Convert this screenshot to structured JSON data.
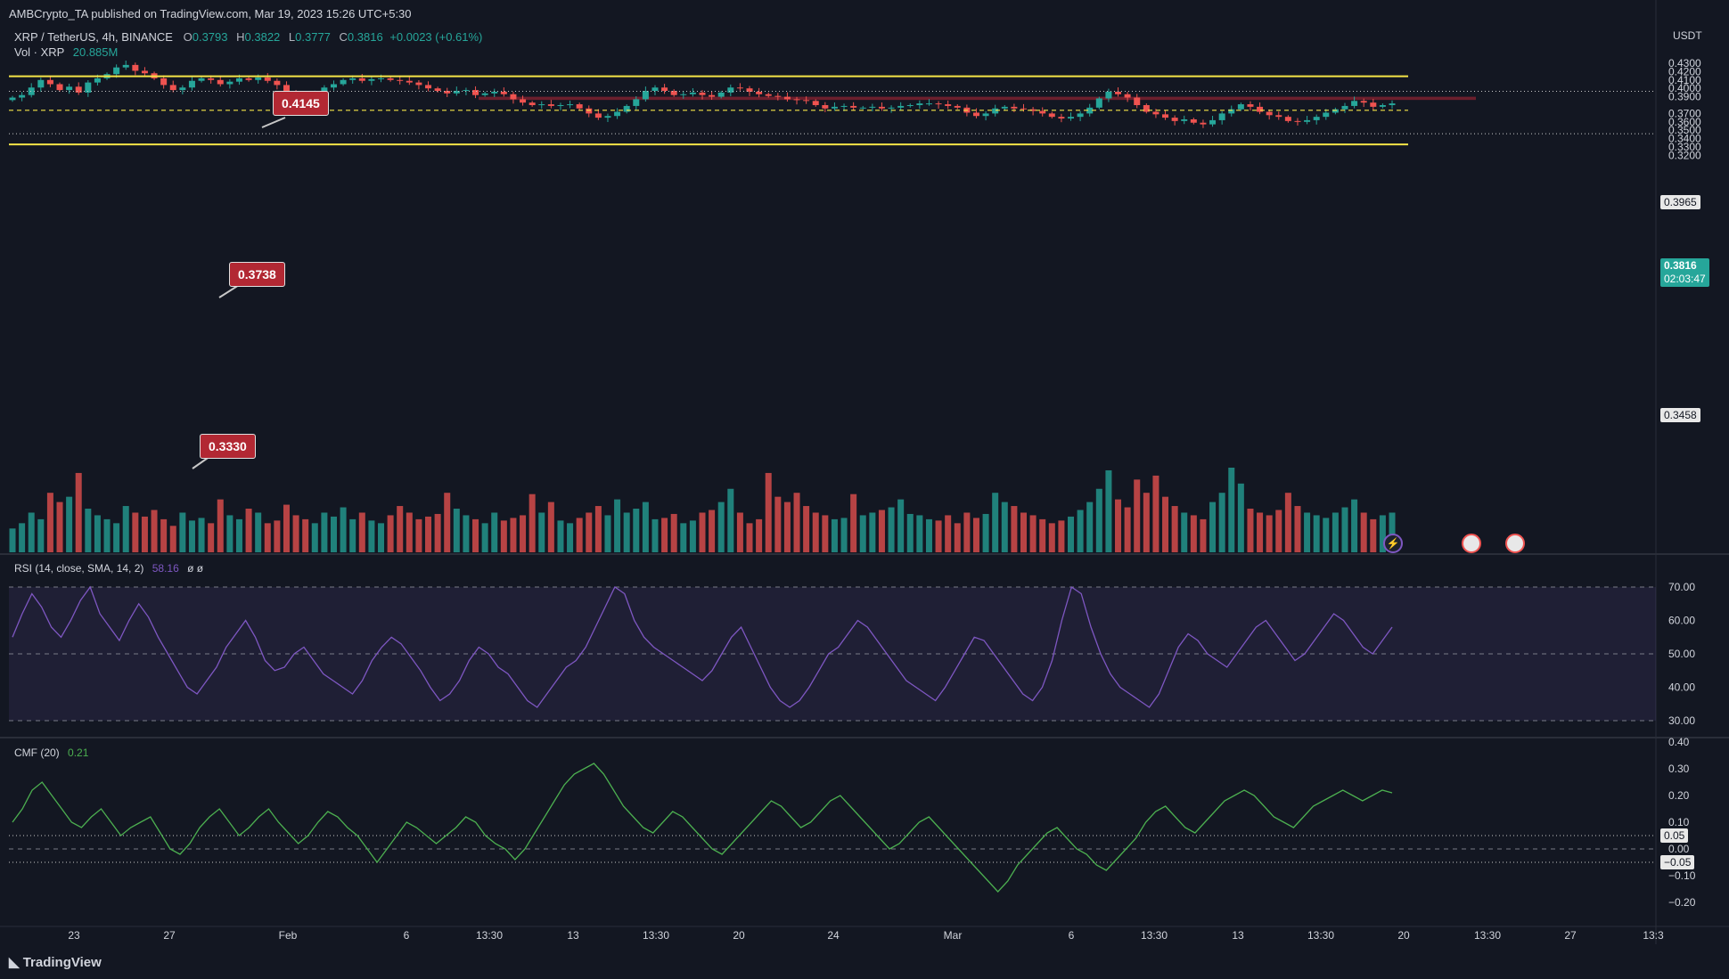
{
  "header": {
    "published": "AMBCrypto_TA published on TradingView.com, Mar 19, 2023 15:26 UTC+5:30",
    "symbol": "XRP / TetherUS, 4h, BINANCE",
    "o_label": "O",
    "o": "0.3793",
    "h_label": "H",
    "h": "0.3822",
    "l_label": "L",
    "l": "0.3777",
    "c_label": "C",
    "c": "0.3816",
    "change": "+0.0023 (+0.61%)",
    "vol_label": "Vol · XRP",
    "vol": "20.885M"
  },
  "currency": "USDT",
  "price_axis": [
    "0.4300",
    "0.4200",
    "0.4100",
    "0.4000",
    "0.3900",
    "0.3700",
    "0.3600",
    "0.3500",
    "0.3400",
    "0.3300",
    "0.3200"
  ],
  "price_tags": {
    "p3965": "0.3965",
    "p3816": "0.3816",
    "countdown": "02:03:47",
    "p3458": "0.3458"
  },
  "annotations": {
    "a1": "0.4145",
    "a2": "0.3738",
    "a3": "0.3330"
  },
  "rsi": {
    "label": "RSI (14, close, SMA, 14, 2)",
    "value": "58.16",
    "extra": "ø  ø",
    "axis": [
      "70.00",
      "60.00",
      "50.00",
      "40.00",
      "30.00"
    ]
  },
  "cmf": {
    "label": "CMF (20)",
    "value": "0.21",
    "axis": [
      "0.40",
      "0.30",
      "0.20",
      "0.10",
      "0.00",
      "−0.10",
      "−0.20"
    ],
    "tag_pos": "0.05",
    "tag_neg": "−0.05"
  },
  "time_axis": [
    "23",
    "27",
    "Feb",
    "6",
    "13:30",
    "13",
    "13:30",
    "20",
    "24",
    "Mar",
    "6",
    "13:30",
    "13",
    "13:30",
    "20",
    "13:30",
    "27",
    "13:3"
  ],
  "footer": {
    "logo": "TradingView"
  },
  "colors": {
    "up": "#26a69a",
    "down": "#ef5350",
    "level": "#f5e547",
    "zone": "#8b2332",
    "rsi": "#7e57c2",
    "cmf": "#4caf50"
  },
  "chart_data": {
    "type": "candlestick",
    "ylim": [
      0.313,
      0.433
    ],
    "levels": [
      0.4145,
      0.3738,
      0.333
    ],
    "dotted_levels": [
      0.3965,
      0.3458
    ],
    "resistance_zone": [
      0.3862,
      0.39
    ],
    "close_series": [
      0.389,
      0.392,
      0.401,
      0.41,
      0.405,
      0.398,
      0.402,
      0.395,
      0.407,
      0.412,
      0.417,
      0.425,
      0.428,
      0.421,
      0.418,
      0.412,
      0.404,
      0.398,
      0.401,
      0.409,
      0.412,
      0.41,
      0.405,
      0.408,
      0.412,
      0.41,
      0.413,
      0.409,
      0.404,
      0.396,
      0.39,
      0.387,
      0.392,
      0.401,
      0.405,
      0.41,
      0.412,
      0.409,
      0.411,
      0.412,
      0.41,
      0.409,
      0.407,
      0.404,
      0.4,
      0.397,
      0.394,
      0.397,
      0.398,
      0.392,
      0.394,
      0.396,
      0.393,
      0.387,
      0.383,
      0.38,
      0.381,
      0.379,
      0.38,
      0.381,
      0.376,
      0.37,
      0.365,
      0.367,
      0.372,
      0.379,
      0.387,
      0.397,
      0.401,
      0.397,
      0.392,
      0.393,
      0.395,
      0.392,
      0.39,
      0.395,
      0.401,
      0.4,
      0.396,
      0.393,
      0.391,
      0.39,
      0.387,
      0.386,
      0.385,
      0.38,
      0.376,
      0.378,
      0.379,
      0.377,
      0.377,
      0.378,
      0.376,
      0.377,
      0.379,
      0.38,
      0.382,
      0.382,
      0.381,
      0.379,
      0.377,
      0.371,
      0.367,
      0.37,
      0.376,
      0.378,
      0.376,
      0.375,
      0.373,
      0.37,
      0.366,
      0.364,
      0.366,
      0.37,
      0.377,
      0.388,
      0.396,
      0.393,
      0.389,
      0.38,
      0.372,
      0.369,
      0.365,
      0.361,
      0.363,
      0.359,
      0.357,
      0.362,
      0.37,
      0.375,
      0.381,
      0.378,
      0.372,
      0.368,
      0.366,
      0.361,
      0.36,
      0.362,
      0.366,
      0.371,
      0.375,
      0.379,
      0.385,
      0.383,
      0.378,
      0.38,
      0.382
    ],
    "volume": [
      18,
      22,
      30,
      25,
      45,
      38,
      42,
      60,
      33,
      28,
      25,
      22,
      35,
      30,
      27,
      32,
      25,
      20,
      30,
      24,
      26,
      22,
      40,
      28,
      25,
      33,
      30,
      22,
      24,
      36,
      28,
      25,
      22,
      30,
      27,
      34,
      25,
      30,
      24,
      22,
      28,
      35,
      30,
      25,
      27,
      29,
      45,
      33,
      28,
      25,
      22,
      30,
      24,
      26,
      28,
      44,
      30,
      38,
      24,
      22,
      26,
      30,
      35,
      28,
      40,
      30,
      33,
      38,
      25,
      26,
      29,
      22,
      24,
      30,
      32,
      38,
      48,
      30,
      22,
      25,
      60,
      42,
      38,
      45,
      35,
      30,
      28,
      25,
      26,
      44,
      28,
      30,
      32,
      34,
      40,
      29,
      28,
      25,
      24,
      28,
      22,
      30,
      26,
      29,
      45,
      38,
      35,
      30,
      28,
      25,
      22,
      24,
      27,
      32,
      38,
      48,
      62,
      40,
      34,
      55,
      45,
      58,
      42,
      35,
      30,
      28,
      25,
      38,
      45,
      64,
      52,
      33,
      30,
      28,
      32,
      45,
      35,
      30,
      28,
      26,
      30,
      34,
      40,
      30,
      25,
      28,
      30
    ],
    "rsi": [
      55,
      62,
      68,
      64,
      58,
      55,
      60,
      66,
      70,
      62,
      58,
      54,
      60,
      65,
      61,
      55,
      50,
      45,
      40,
      38,
      42,
      46,
      52,
      56,
      60,
      55,
      48,
      45,
      46,
      50,
      52,
      48,
      44,
      42,
      40,
      38,
      42,
      48,
      52,
      55,
      53,
      49,
      45,
      40,
      36,
      38,
      42,
      48,
      52,
      50,
      46,
      44,
      40,
      36,
      34,
      38,
      42,
      46,
      48,
      52,
      58,
      64,
      70,
      68,
      60,
      55,
      52,
      50,
      48,
      46,
      44,
      42,
      45,
      50,
      55,
      58,
      52,
      46,
      40,
      36,
      34,
      36,
      40,
      45,
      50,
      52,
      56,
      60,
      58,
      54,
      50,
      46,
      42,
      40,
      38,
      36,
      40,
      45,
      50,
      55,
      54,
      50,
      46,
      42,
      38,
      36,
      40,
      48,
      60,
      70,
      68,
      58,
      50,
      44,
      40,
      38,
      36,
      34,
      38,
      45,
      52,
      56,
      54,
      50,
      48,
      46,
      50,
      54,
      58,
      60,
      56,
      52,
      48,
      50,
      54,
      58,
      62,
      60,
      56,
      52,
      50,
      54,
      58
    ],
    "cmf": [
      0.1,
      0.15,
      0.22,
      0.25,
      0.2,
      0.15,
      0.1,
      0.08,
      0.12,
      0.15,
      0.1,
      0.05,
      0.08,
      0.1,
      0.12,
      0.06,
      0.0,
      -0.02,
      0.02,
      0.08,
      0.12,
      0.15,
      0.1,
      0.05,
      0.08,
      0.12,
      0.15,
      0.1,
      0.06,
      0.02,
      0.05,
      0.1,
      0.14,
      0.12,
      0.08,
      0.05,
      0.0,
      -0.05,
      0.0,
      0.05,
      0.1,
      0.08,
      0.05,
      0.02,
      0.05,
      0.08,
      0.12,
      0.1,
      0.05,
      0.02,
      0.0,
      -0.04,
      0.0,
      0.06,
      0.12,
      0.18,
      0.24,
      0.28,
      0.3,
      0.32,
      0.28,
      0.22,
      0.16,
      0.12,
      0.08,
      0.06,
      0.1,
      0.14,
      0.12,
      0.08,
      0.04,
      0.0,
      -0.02,
      0.02,
      0.06,
      0.1,
      0.14,
      0.18,
      0.16,
      0.12,
      0.08,
      0.1,
      0.14,
      0.18,
      0.2,
      0.16,
      0.12,
      0.08,
      0.04,
      0.0,
      0.02,
      0.06,
      0.1,
      0.12,
      0.08,
      0.04,
      0.0,
      -0.04,
      -0.08,
      -0.12,
      -0.16,
      -0.12,
      -0.06,
      -0.02,
      0.02,
      0.06,
      0.08,
      0.04,
      0.0,
      -0.02,
      -0.06,
      -0.08,
      -0.04,
      0.0,
      0.04,
      0.1,
      0.14,
      0.16,
      0.12,
      0.08,
      0.06,
      0.1,
      0.14,
      0.18,
      0.2,
      0.22,
      0.2,
      0.16,
      0.12,
      0.1,
      0.08,
      0.12,
      0.16,
      0.18,
      0.2,
      0.22,
      0.2,
      0.18,
      0.2,
      0.22,
      0.21
    ]
  }
}
